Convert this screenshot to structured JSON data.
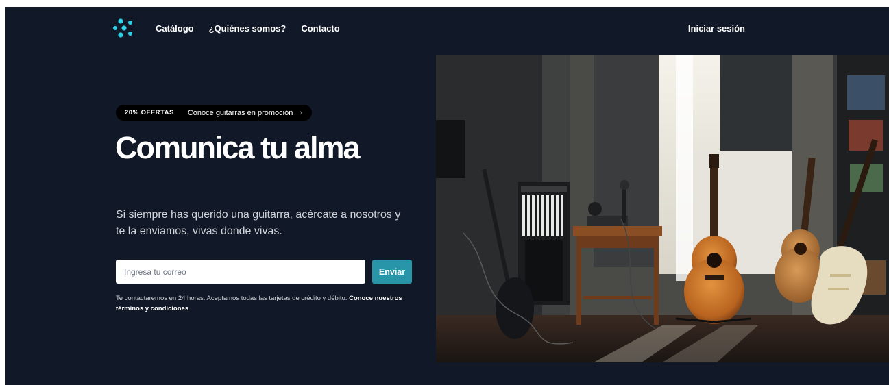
{
  "nav": {
    "logo_icon": "brand-dots-logo",
    "links": [
      "Catálogo",
      "¿Quiénes somos?",
      "Contacto"
    ],
    "login_label": "Iniciar sesión"
  },
  "promo": {
    "tag": "20% OFERTAS",
    "text": "Conoce guitarras en promoción",
    "chevron": "›"
  },
  "hero": {
    "headline": "Comunica tu alma",
    "subtitle": "Si siempre has querido una guitarra, acércate a nosotros y te la enviamos, vivas donde vivas."
  },
  "form": {
    "email_placeholder": "Ingresa tu correo",
    "submit_label": "Enviar",
    "notice": "Te contactaremos en 24 horas. Aceptamos todas las tarjetas de crédito y débito.",
    "terms_link": "Conoce nuestros términos y condiciones",
    "terms_suffix": "."
  },
  "colors": {
    "background": "#111827",
    "accent": "#2896a8",
    "logo": "#2dd4e8"
  }
}
